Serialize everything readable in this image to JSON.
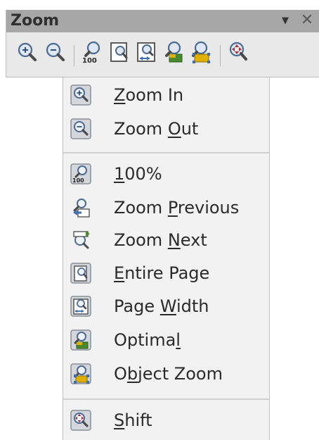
{
  "toolbar": {
    "title": "Zoom",
    "menu_arrow": "▼",
    "close_glyph": "✕",
    "buttons": [
      {
        "icon": "zoom-in-icon"
      },
      {
        "icon": "zoom-out-icon"
      },
      {
        "icon": "zoom-100-icon"
      },
      {
        "icon": "entire-page-icon"
      },
      {
        "icon": "page-width-icon"
      },
      {
        "icon": "optimal-icon"
      },
      {
        "icon": "object-zoom-icon"
      },
      {
        "icon": "shift-icon"
      }
    ]
  },
  "menu": {
    "items": [
      {
        "pre": "",
        "ul": "Z",
        "post": "oom In",
        "icon": "zoom-in-icon"
      },
      {
        "pre": "Zoom ",
        "ul": "O",
        "post": "ut",
        "icon": "zoom-out-icon"
      },
      {
        "pre": "",
        "ul": "1",
        "post": "00%",
        "icon": "zoom-100-icon"
      },
      {
        "pre": "Zoom ",
        "ul": "P",
        "post": "revious",
        "icon": "zoom-previous-icon"
      },
      {
        "pre": "Zoom ",
        "ul": "N",
        "post": "ext",
        "icon": "zoom-next-icon"
      },
      {
        "pre": "",
        "ul": "E",
        "post": "ntire Page",
        "icon": "entire-page-icon"
      },
      {
        "pre": "Page ",
        "ul": "W",
        "post": "idth",
        "icon": "page-width-icon"
      },
      {
        "pre": "Optima",
        "ul": "l",
        "post": "",
        "icon": "optimal-icon"
      },
      {
        "pre": "O",
        "ul": "b",
        "post": "ject Zoom",
        "icon": "object-zoom-icon"
      },
      {
        "pre": "",
        "ul": "S",
        "post": "hift",
        "icon": "shift-icon"
      }
    ]
  },
  "colors": {
    "titlebar": "#a7a7a7",
    "toolbar_bg": "#e9e9e9",
    "menu_bg": "#f2f2f2",
    "icon_frame": "#9aa0a8",
    "lens": "#5b7fb0",
    "accent_yellow": "#e0b000",
    "accent_green": "#4a8a2e",
    "accent_blue": "#3a6fb5"
  }
}
